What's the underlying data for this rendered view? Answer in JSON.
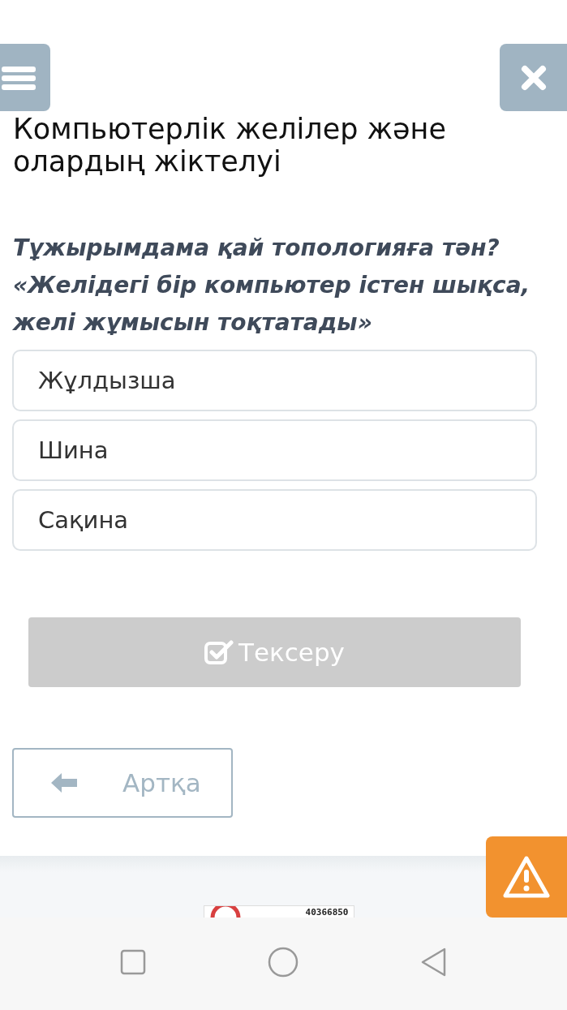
{
  "title": "Компьютерлік желілер және олардың жіктелуі",
  "question": "Тұжырымдама қай топологияға тән? «Желідегі бір компьютер істен шықса, желі жұмысын тоқтатады»",
  "options": [
    {
      "label": "Жұлдызша",
      "selected": false
    },
    {
      "label": "Шина",
      "selected": false
    },
    {
      "label": "Сақина",
      "selected": false
    }
  ],
  "check_button": {
    "label": "Тексеру",
    "disabled": true
  },
  "back_button": {
    "label": "Артқа"
  },
  "footer_badge": {
    "text": "40366850"
  }
}
